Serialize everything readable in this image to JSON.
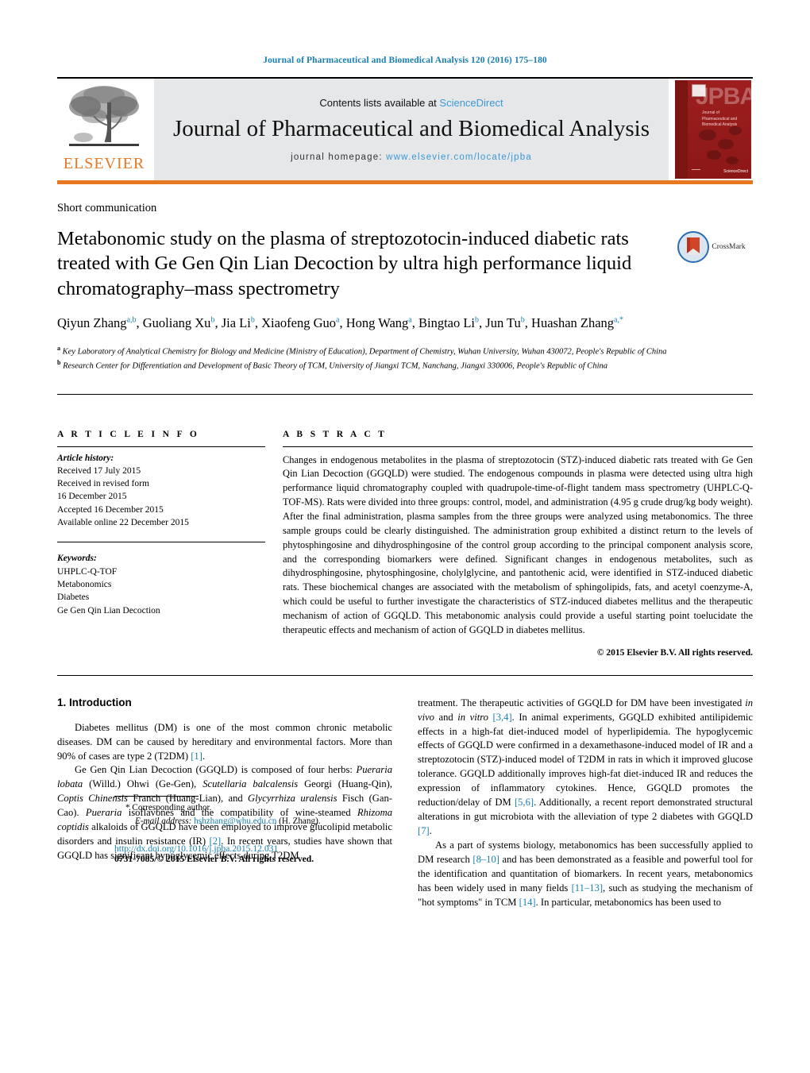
{
  "running_head": "Journal of Pharmaceutical and Biomedical Analysis 120 (2016) 175–180",
  "masthead": {
    "publisher_name": "ELSEVIER",
    "contents_prefix": "Contents lists available at ",
    "contents_link": "ScienceDirect",
    "journal_title": "Journal of Pharmaceutical and Biomedical Analysis",
    "homepage_prefix": "journal homepage: ",
    "homepage_url": "www.elsevier.com/locate/jpba",
    "cover": {
      "acronym": "JPBA",
      "subtitle": "Journal of Pharmaceutical and Biomedical Analysis",
      "footer_mark": "ScienceDirect"
    },
    "accent_color": "#E87722",
    "link_color": "#3a9ad9"
  },
  "article": {
    "section_type": "Short communication",
    "title": "Metabonomic study on the plasma of streptozotocin-induced diabetic rats treated with Ge Gen Qin Lian Decoction by ultra high performance liquid chromatography–mass spectrometry",
    "crossmark_label": "CrossMark",
    "authors": [
      {
        "name": "Qiyun Zhang",
        "marks": "a,b",
        "sep": ", "
      },
      {
        "name": "Guoliang Xu",
        "marks": "b",
        "sep": ", "
      },
      {
        "name": "Jia Li",
        "marks": "b",
        "sep": ", "
      },
      {
        "name": "Xiaofeng Guo",
        "marks": "a",
        "sep": ", "
      },
      {
        "name": "Hong Wang",
        "marks": "a",
        "sep": ", "
      },
      {
        "name": "Bingtao Li",
        "marks": "b",
        "sep": ", "
      },
      {
        "name": "Jun Tu",
        "marks": "b",
        "sep": ", "
      },
      {
        "name": "Huashan Zhang",
        "marks": "a,*",
        "sep": ""
      }
    ],
    "affiliations": [
      {
        "mark": "a",
        "text": "Key Laboratory of Analytical Chemistry for Biology and Medicine (Ministry of Education), Department of Chemistry, Wuhan University, Wuhan 430072, People's Republic of China"
      },
      {
        "mark": "b",
        "text": "Research Center for Differentiation and Development of Basic Theory of TCM, University of Jiangxi TCM, Nanchang, Jiangxi 330006, People's Republic of China"
      }
    ]
  },
  "article_info": {
    "heading": "A R T I C L E   I N F O",
    "history_label": "Article history:",
    "history": [
      "Received 17 July 2015",
      "Received in revised form",
      "16 December 2015",
      "Accepted 16 December 2015",
      "Available online 22 December 2015"
    ],
    "keywords_label": "Keywords:",
    "keywords": [
      "UHPLC-Q-TOF",
      "Metabonomics",
      "Diabetes",
      "Ge Gen Qin Lian Decoction"
    ]
  },
  "abstract": {
    "heading": "A B S T R A C T",
    "text": "Changes in endogenous metabolites in the plasma of streptozotocin (STZ)-induced diabetic rats treated with Ge Gen Qin Lian Decoction (GGQLD) were studied. The endogenous compounds in plasma were detected using ultra high performance liquid chromatography coupled with quadrupole-time-of-flight tandem mass spectrometry (UHPLC-Q-TOF-MS). Rats were divided into three groups: control, model, and administration (4.95 g crude drug/kg body weight). After the final administration, plasma samples from the three groups were analyzed using metabonomics. The three sample groups could be clearly distinguished. The administration group exhibited a distinct return to the levels of phytosphingosine and dihydrosphingosine of the control group according to the principal component analysis score, and the corresponding biomarkers were defined. Significant changes in endogenous metabolites, such as dihydrosphingosine, phytosphingosine, cholylglycine, and pantothenic acid, were identified in STZ-induced diabetic rats. These biochemical changes are associated with the metabolism of sphingolipids, fats, and acetyl coenzyme-A, which could be useful to further investigate the characteristics of STZ-induced diabetes mellitus and the therapeutic mechanism of action of GGQLD. This metabonomic analysis could provide a useful starting point toelucidate the therapeutic effects and mechanism of action of GGQLD in diabetes mellitus.",
    "copyright": "© 2015 Elsevier B.V. All rights reserved."
  },
  "introduction": {
    "heading": "1.  Introduction",
    "left_paragraphs": [
      "Diabetes mellitus (DM) is one of the most common chronic metabolic diseases. DM can be caused by hereditary and environmental factors. More than 90% of cases are type 2 (T2DM) [1].",
      "Ge Gen Qin Lian Decoction (GGQLD) is composed of four herbs: Pueraria lobata (Willd.) Ohwi (Ge-Gen), Scutellaria balcalensis Georgi (Huang-Qin), Coptis Chinensis Franch (Huang-Lian), and Glycyrrhiza uralensis Fisch (Gan-Cao). Pueraria isoflavones and the compatibility of wine-steamed Rhizoma coptidis alkaloids of GGQLD have been employed to improve glucolipid metabolic disorders and insulin resistance (IR) [2]. In recent years, studies have shown that GGQLD has significant hypoglycemic effects during T2DM"
    ],
    "right_paragraphs": [
      "treatment. The therapeutic activities of GGQLD for DM have been investigated in vivo and in vitro [3,4]. In animal experiments, GGQLD exhibited antilipidemic effects in a high-fat diet-induced model of hyperlipidemia. The hypoglycemic effects of GGQLD were confirmed in a dexamethasone-induced model of IR and a streptozotocin (STZ)-induced model of T2DM in rats in which it improved glucose tolerance. GGQLD additionally improves high-fat diet-induced IR and reduces the expression of inflammatory cytokines. Hence, GGQLD promotes the reduction/delay of DM [5,6]. Additionally, a recent report demonstrated structural alterations in gut microbiota with the alleviation of type 2 diabetes with GGQLD [7].",
      "As a part of systems biology, metabonomics has been successfully applied to DM research [8–10] and has been demonstrated as a feasible and powerful tool for the identification and quantitation of biomarkers. In recent years, metabonomics has been widely used in many fields [11–13], such as studying the mechanism of \"hot symptoms\" in TCM [14]. In particular, metabonomics has been used to"
    ]
  },
  "footnotes": {
    "corresponding_marker": "*",
    "corresponding_label": "Corresponding author.",
    "email_label": "E-mail address:",
    "email": "hshzhang@whu.edu.cn",
    "email_suffix": "(H. Zhang).",
    "doi": "http://dx.doi.org/10.1016/j.jpba.2015.12.031",
    "issn_line": "0731-7085/© 2015 Elsevier B.V. All rights reserved."
  }
}
